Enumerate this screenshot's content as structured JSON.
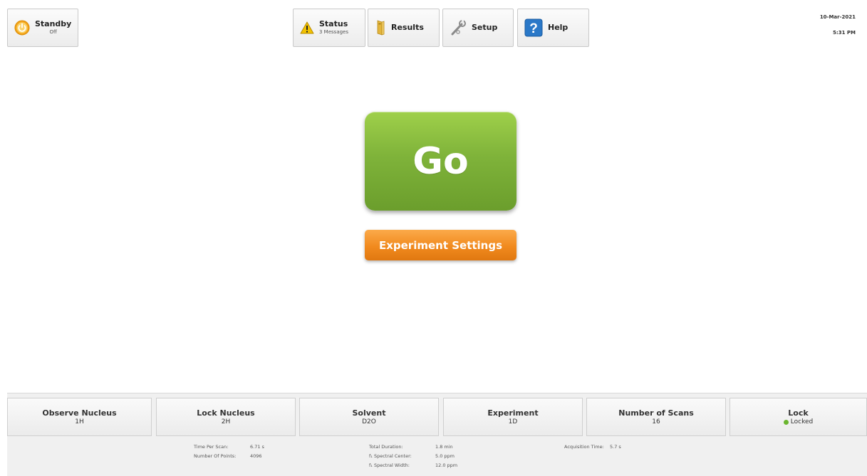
{
  "toolbar": {
    "standby": {
      "label": "Standby",
      "sub": "Off",
      "icon": "power-icon"
    },
    "status": {
      "label": "Status",
      "sub": "3 Messages",
      "icon": "warning-icon"
    },
    "results": {
      "label": "Results",
      "icon": "folder-icon"
    },
    "setup": {
      "label": "Setup",
      "icon": "wrench-icon"
    },
    "help": {
      "label": "Help",
      "icon": "help-icon"
    }
  },
  "datetime": {
    "date": "10-Mar-2021",
    "time": "5:31 PM"
  },
  "main": {
    "go_label": "Go",
    "experiment_settings_label": "Experiment Settings"
  },
  "params": [
    {
      "title": "Observe Nucleus",
      "value": "1H"
    },
    {
      "title": "Lock Nucleus",
      "value": "2H"
    },
    {
      "title": "Solvent",
      "value": "D2O"
    },
    {
      "title": "Experiment",
      "value": "1D"
    },
    {
      "title": "Number of Scans",
      "value": "16"
    },
    {
      "title": "Lock",
      "value": "Locked"
    }
  ],
  "info": {
    "time_per_scan": {
      "label": "Time Per Scan:",
      "value": "6.71 s"
    },
    "number_of_points": {
      "label": "Number Of Points:",
      "value": "4096"
    },
    "total_duration": {
      "label": "Total Duration:",
      "value": "1.8 min"
    },
    "spectral_center": {
      "label": "f₁ Spectral Center:",
      "value": "5.0 ppm"
    },
    "spectral_width": {
      "label": "f₁ Spectral Width:",
      "value": "12.0 ppm"
    },
    "acquisition_time": {
      "label": "Acquisition Time:",
      "value": "5.7 s"
    }
  },
  "colors": {
    "go": "#7fb33a",
    "experiment_settings": "#f18a1e",
    "lock_status": "#6ab52e",
    "warning": "#f2c200",
    "help": "#2a78c8"
  }
}
